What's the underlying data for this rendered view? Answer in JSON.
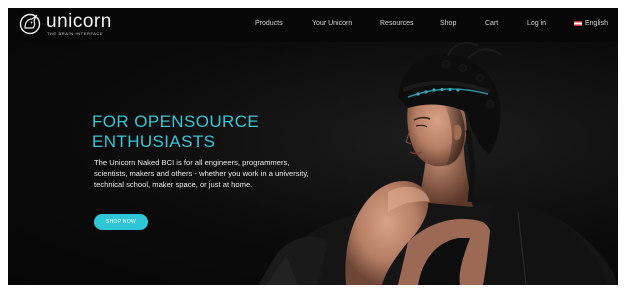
{
  "brand": {
    "name": "unicorn",
    "tagline": "THE BRAIN INTERFACE",
    "icon": "unicorn-head-logo-icon"
  },
  "nav": {
    "items": [
      "Products",
      "Your Unicorn",
      "Resources",
      "Shop",
      "Cart",
      "Log in"
    ],
    "language": {
      "label": "English",
      "flag": "uk-flag-icon"
    }
  },
  "hero": {
    "headline": [
      "FOR OPENSOURCE",
      "ENTHUSIASTS"
    ],
    "body": "The Unicorn Naked BCI is for all engineers, programmers, scientists, makers and others - whether you work in a university, technical school, maker space, or just at home.",
    "cta_label": "SHOP NOW",
    "image": "woman-wearing-eeg-cap-photo"
  },
  "colors": {
    "accent": "#39c6d6",
    "button": "#2fc6d8",
    "background": "#0b0b0b",
    "nav_text": "#d7d7d7"
  }
}
